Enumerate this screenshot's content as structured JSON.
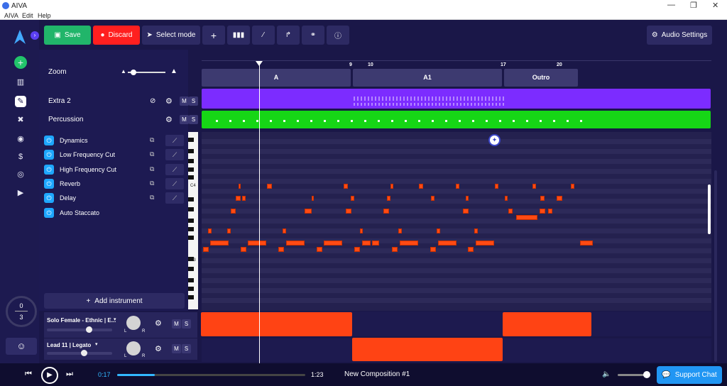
{
  "window": {
    "title": "AIVA",
    "controls": [
      "—",
      "❐",
      "✕"
    ]
  },
  "menu": [
    "AIVA",
    "Edit",
    "Help"
  ],
  "toolbar": {
    "save": "Save",
    "discard": "Discard",
    "select_mode": "Select mode",
    "audio_settings": "Audio Settings"
  },
  "zoom_label": "Zoom",
  "zoom_level": 0.25,
  "tracks_header": [
    {
      "name": "Extra 2"
    },
    {
      "name": "Percussion"
    }
  ],
  "effects": [
    "Dynamics",
    "Low Frequency Cut",
    "High Frequency Cut",
    "Reverb",
    "Delay",
    "Auto Staccato"
  ],
  "add_instrument": "Add instrument",
  "counter": {
    "top": "0",
    "bottom": "3"
  },
  "instruments": [
    {
      "name": "Solo Female - Ethnic | E...",
      "volume": 0.55
    },
    {
      "name": "Lead 11 | Legato",
      "volume": 0.5
    }
  ],
  "ms": {
    "m": "M",
    "s": "S"
  },
  "measures": [
    "9",
    "10",
    "17",
    "20"
  ],
  "sections": [
    "A",
    "A1",
    "Outro"
  ],
  "piano_labels": [
    "C4",
    "C3"
  ],
  "transport": {
    "current": "0:17",
    "total": "1:23",
    "progress": 0.2,
    "title": "New Composition #1",
    "volume": 0.9,
    "support": "Support Chat"
  },
  "colors": {
    "save": "#21b56a",
    "discard": "#ff1f1f",
    "track_purple": "#7c2cff",
    "track_green": "#16d616",
    "note": "#ff4a14",
    "accent": "#1ea7ff"
  }
}
